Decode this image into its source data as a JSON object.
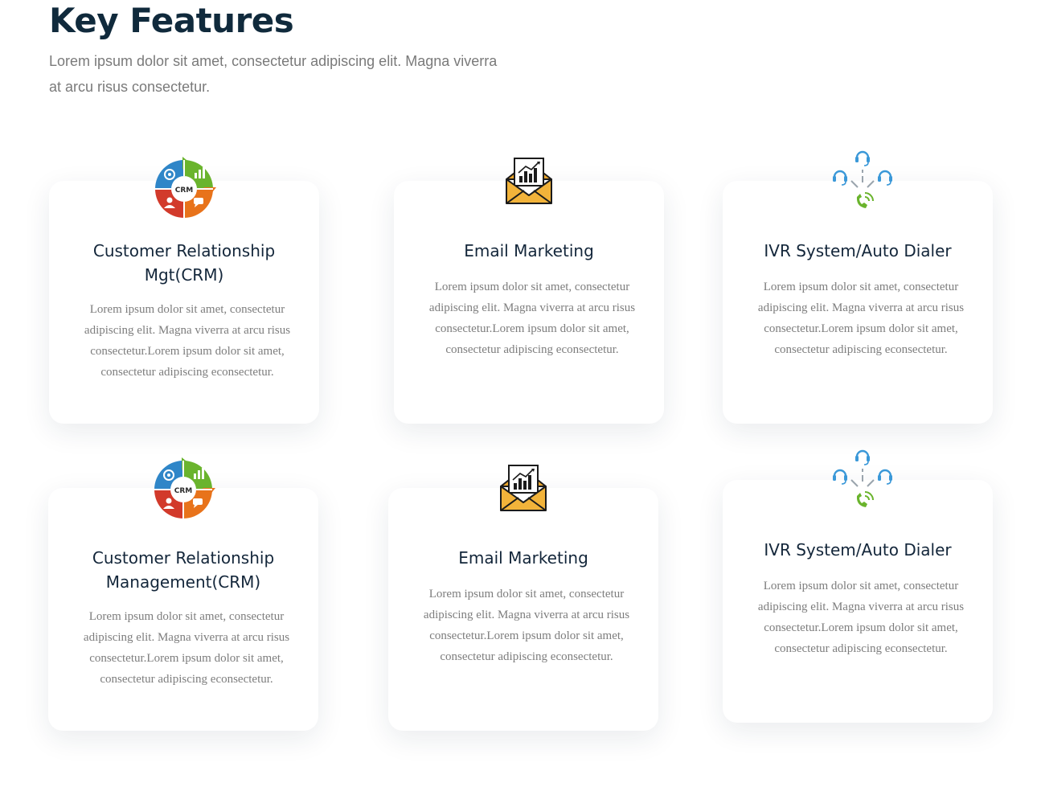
{
  "header": {
    "title": "Key Features",
    "subtitle": "Lorem ipsum dolor sit amet, consectetur adipiscing elit. Magna viverra at arcu risus consectetur."
  },
  "icons": {
    "crm": "crm-cycle-icon",
    "email": "email-marketing-icon",
    "ivr": "ivr-dialer-icon",
    "crm_label": "CRM"
  },
  "colors": {
    "title": "#102a3c",
    "body_text": "#7d7d7d",
    "crm_blue": "#2f86c8",
    "crm_green": "#6ab42d",
    "crm_orange": "#e8731b",
    "crm_red": "#d23a2b",
    "email_yellow": "#f2b33a",
    "ivr_blue": "#3a98d8",
    "ivr_green": "#6ab42d"
  },
  "cards": [
    {
      "title": "Customer Relationship Mgt(CRM)",
      "text": "Lorem ipsum dolor sit amet, consectetur adipiscing elit. Magna viverra at arcu risus consectetur.Lorem ipsum dolor sit amet, consectetur adipiscing econsectetur."
    },
    {
      "title": "Email Marketing",
      "text": "Lorem ipsum dolor sit amet, consectetur adipiscing elit. Magna viverra at arcu risus consectetur.Lorem ipsum dolor sit amet, consectetur adipiscing econsectetur."
    },
    {
      "title": "IVR System/Auto Dialer",
      "text": "Lorem ipsum dolor sit amet, consectetur adipiscing elit. Magna viverra at arcu risus consectetur.Lorem ipsum dolor sit amet, consectetur adipiscing econsectetur."
    },
    {
      "title": "Customer Relationship Management(CRM)",
      "text": "Lorem ipsum dolor sit amet, consectetur adipiscing elit. Magna viverra at arcu risus consectetur.Lorem ipsum dolor sit amet, consectetur adipiscing econsectetur."
    },
    {
      "title": "Email Marketing",
      "text": "Lorem ipsum dolor sit amet, consectetur adipiscing elit. Magna viverra at arcu risus consectetur.Lorem ipsum dolor sit amet, consectetur adipiscing econsectetur."
    },
    {
      "title": "IVR System/Auto Dialer",
      "text": "Lorem ipsum dolor sit amet, consectetur adipiscing elit. Magna viverra at arcu risus consectetur.Lorem ipsum dolor sit amet, consectetur adipiscing econsectetur."
    }
  ]
}
